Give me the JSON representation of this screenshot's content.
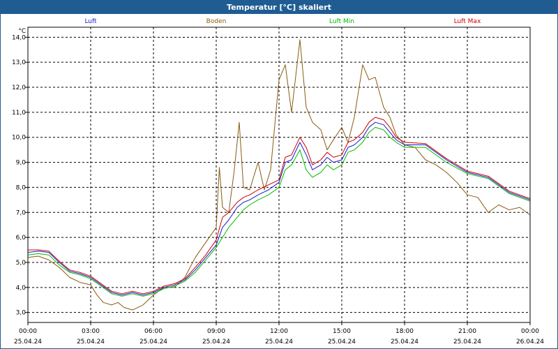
{
  "window": {
    "title": "Temperatur [°C] skaliert"
  },
  "colors": {
    "titlebar": "#1f5c92",
    "grid": "#000000"
  },
  "chart_data": {
    "type": "line",
    "title": "Temperatur [°C] skaliert",
    "ylabel": "°C",
    "xlabel": "",
    "ylim": [
      2.6,
      14.4
    ],
    "y_ticks": [
      3.0,
      4.0,
      5.0,
      6.0,
      7.0,
      8.0,
      9.0,
      10.0,
      11.0,
      12.0,
      13.0,
      14.0
    ],
    "y_tick_labels": [
      "3,0",
      "4,0",
      "5,0",
      "6,0",
      "7,0",
      "8,0",
      "9,0",
      "10,0",
      "11,0",
      "12,0",
      "13,0",
      "14,0"
    ],
    "xlim": [
      0,
      24
    ],
    "x_ticks": [
      0,
      3,
      6,
      9,
      12,
      15,
      18,
      21,
      24
    ],
    "x_tick_labels": [
      "00:00",
      "03:00",
      "06:00",
      "09:00",
      "12:00",
      "15:00",
      "18:00",
      "21:00",
      "00:00"
    ],
    "x_tick_dates": [
      "25.04.24",
      "25.04.24",
      "25.04.24",
      "25.04.24",
      "25.04.24",
      "25.04.24",
      "25.04.24",
      "25.04.24",
      "26.04.24"
    ],
    "grid": true,
    "legend": "top",
    "series": [
      {
        "name": "Luft",
        "color": "#1a1acc",
        "x": [
          0,
          0.5,
          1,
          1.5,
          2,
          2.5,
          3,
          3.5,
          4,
          4.5,
          5,
          5.5,
          6,
          6.5,
          7,
          7.5,
          8,
          8.5,
          9,
          9.3,
          9.6,
          10,
          10.3,
          10.6,
          11,
          11.5,
          12,
          12.3,
          12.6,
          13,
          13.3,
          13.6,
          14,
          14.3,
          14.6,
          15,
          15.3,
          15.6,
          16,
          16.3,
          16.6,
          17,
          17.3,
          17.6,
          18,
          19,
          20,
          21,
          22,
          23,
          24
        ],
        "values": [
          5.4,
          5.45,
          5.4,
          5.0,
          4.65,
          4.55,
          4.4,
          4.1,
          3.8,
          3.7,
          3.8,
          3.7,
          3.8,
          4.0,
          4.1,
          4.3,
          4.7,
          5.2,
          5.7,
          6.4,
          6.7,
          7.2,
          7.4,
          7.5,
          7.7,
          7.9,
          8.2,
          9.0,
          9.1,
          9.8,
          9.3,
          8.7,
          8.9,
          9.2,
          9.0,
          9.1,
          9.6,
          9.7,
          10.0,
          10.4,
          10.6,
          10.5,
          10.2,
          9.9,
          9.7,
          9.7,
          9.1,
          8.6,
          8.4,
          7.8,
          7.5
        ]
      },
      {
        "name": "Boden",
        "color": "#8a5a10",
        "x": [
          0,
          0.5,
          1,
          1.5,
          2,
          2.5,
          3,
          3.3,
          3.6,
          4,
          4.3,
          4.6,
          5,
          5.5,
          6,
          6.5,
          7,
          7.5,
          8,
          8.5,
          9,
          9.15,
          9.3,
          9.6,
          9.85,
          10.1,
          10.3,
          10.6,
          11,
          11.3,
          11.6,
          12,
          12.3,
          12.6,
          13,
          13.3,
          13.6,
          14,
          14.3,
          14.6,
          15,
          15.3,
          15.6,
          16,
          16.3,
          16.6,
          17,
          17.3,
          17.6,
          18,
          18.5,
          19,
          19.5,
          20,
          20.5,
          21,
          21.5,
          22,
          22.5,
          23,
          23.5,
          24
        ],
        "values": [
          5.2,
          5.25,
          5.1,
          4.8,
          4.4,
          4.2,
          4.1,
          3.7,
          3.4,
          3.3,
          3.4,
          3.2,
          3.1,
          3.3,
          3.7,
          4.0,
          4.0,
          4.4,
          5.2,
          5.8,
          6.4,
          8.8,
          7.2,
          7.0,
          8.6,
          10.6,
          8.0,
          7.9,
          9.0,
          7.9,
          8.7,
          12.3,
          12.9,
          11.0,
          13.9,
          11.2,
          10.6,
          10.3,
          9.5,
          9.9,
          10.4,
          9.8,
          10.8,
          12.9,
          12.3,
          12.4,
          11.2,
          10.8,
          10.1,
          9.7,
          9.6,
          9.1,
          8.9,
          8.6,
          8.2,
          7.7,
          7.6,
          7.0,
          7.3,
          7.1,
          7.2,
          6.9
        ]
      },
      {
        "name": "Luft Min",
        "color": "#00bb00",
        "x": [
          0,
          0.5,
          1,
          1.5,
          2,
          2.5,
          3,
          3.5,
          4,
          4.5,
          5,
          5.5,
          6,
          6.5,
          7,
          7.5,
          8,
          8.5,
          9,
          9.3,
          9.6,
          10,
          10.3,
          10.6,
          11,
          11.5,
          12,
          12.3,
          12.6,
          13,
          13.3,
          13.6,
          14,
          14.3,
          14.6,
          15,
          15.3,
          15.6,
          16,
          16.3,
          16.6,
          17,
          17.3,
          17.6,
          18,
          19,
          20,
          21,
          22,
          23,
          24
        ],
        "values": [
          5.3,
          5.35,
          5.3,
          4.9,
          4.6,
          4.5,
          4.35,
          4.05,
          3.75,
          3.65,
          3.75,
          3.65,
          3.75,
          3.95,
          4.05,
          4.25,
          4.6,
          5.1,
          5.6,
          6.0,
          6.4,
          6.8,
          7.1,
          7.3,
          7.5,
          7.7,
          8.0,
          8.7,
          8.9,
          9.5,
          8.7,
          8.4,
          8.6,
          8.9,
          8.7,
          8.9,
          9.4,
          9.5,
          9.8,
          10.2,
          10.4,
          10.3,
          10.0,
          9.8,
          9.6,
          9.6,
          9.0,
          8.55,
          8.35,
          7.75,
          7.45
        ]
      },
      {
        "name": "Luft Max",
        "color": "#cc0000",
        "x": [
          0,
          0.5,
          1,
          1.5,
          2,
          2.5,
          3,
          3.5,
          4,
          4.5,
          5,
          5.5,
          6,
          6.5,
          7,
          7.5,
          8,
          8.5,
          9,
          9.3,
          9.6,
          10,
          10.3,
          10.6,
          11,
          11.5,
          12,
          12.3,
          12.6,
          13,
          13.3,
          13.6,
          14,
          14.3,
          14.6,
          15,
          15.3,
          15.6,
          16,
          16.3,
          16.6,
          17,
          17.3,
          17.6,
          18,
          19,
          20,
          21,
          22,
          23,
          24
        ],
        "values": [
          5.5,
          5.5,
          5.45,
          5.05,
          4.7,
          4.6,
          4.45,
          4.15,
          3.85,
          3.75,
          3.85,
          3.75,
          3.85,
          4.05,
          4.15,
          4.35,
          4.8,
          5.3,
          5.9,
          6.8,
          7.0,
          7.4,
          7.6,
          7.7,
          7.9,
          8.1,
          8.3,
          9.2,
          9.3,
          10.0,
          9.6,
          8.9,
          9.1,
          9.4,
          9.2,
          9.3,
          9.8,
          9.9,
          10.2,
          10.6,
          10.8,
          10.7,
          10.4,
          10.0,
          9.8,
          9.75,
          9.15,
          8.65,
          8.45,
          7.85,
          7.55
        ]
      }
    ]
  }
}
